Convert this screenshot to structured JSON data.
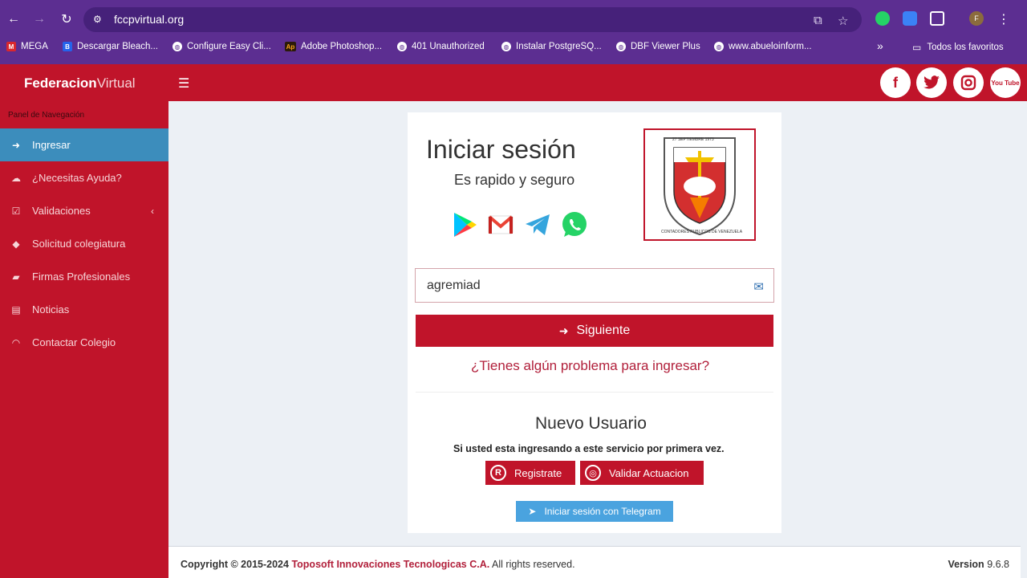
{
  "browser": {
    "url": "fccpvirtual.org",
    "bookmarks": [
      {
        "label": "MEGA",
        "fav": "M"
      },
      {
        "label": "Descargar Bleach...",
        "fav": "B"
      },
      {
        "label": "Configure Easy Cli...",
        "fav": ""
      },
      {
        "label": "Adobe Photoshop...",
        "fav": "Ap"
      },
      {
        "label": "401 Unauthorized",
        "fav": ""
      },
      {
        "label": "Instalar PostgreSQ...",
        "fav": ""
      },
      {
        "label": "DBF Viewer Plus",
        "fav": ""
      },
      {
        "label": "www.abueloinform...",
        "fav": ""
      }
    ],
    "all_bookmarks": "Todos los favoritos",
    "more": "»",
    "profile_initial": "F"
  },
  "header": {
    "logo_bold": "Federacion",
    "logo_light": "Virtual",
    "social": [
      "f",
      "t",
      "ig",
      "You Tube"
    ]
  },
  "sidebar": {
    "title": "Panel de Navegación",
    "items": [
      {
        "label": "Ingresar",
        "icon": "sign-in-icon"
      },
      {
        "label": "¿Necesitas Ayuda?",
        "icon": "chat-icon"
      },
      {
        "label": "Validaciones",
        "icon": "check-square-icon"
      },
      {
        "label": "Solicitud colegiatura",
        "icon": "tag-icon"
      },
      {
        "label": "Firmas Profesionales",
        "icon": "folder-icon"
      },
      {
        "label": "Noticias",
        "icon": "newspaper-icon"
      },
      {
        "label": "Contactar Colegio",
        "icon": "rss-icon"
      }
    ]
  },
  "login": {
    "title": "Iniciar sesión",
    "subtitle": "Es rapido y seguro",
    "seal_top_text": "27 SEPTIEMBRE 1973",
    "seal_ring_text": "CONTADORES PUBLICOS DE VENEZUELA",
    "input_value": "agremiad",
    "next_label": "Siguiente",
    "problem_link": "¿Tienes algún problema para ingresar?"
  },
  "new_user": {
    "title": "Nuevo Usuario",
    "description": "Si usted esta ingresando a este servicio por primera vez.",
    "register_label": "Registrate",
    "register_icon_letter": "R",
    "validate_label": "Validar Actuacion",
    "telegram_label": "Iniciar sesión con Telegram"
  },
  "footer": {
    "copyright": "Copyright © 2015-2024",
    "company": "Toposoft Innovaciones Tecnologicas C.A.",
    "rights": "All rights reserved.",
    "version_label": "Version",
    "version_number": "9.6.8"
  },
  "colors": {
    "brand_red": "#c0142a",
    "chrome_purple": "#5c2e91",
    "active_blue": "#3c8dbc",
    "telegram_blue": "#4aa3df"
  }
}
